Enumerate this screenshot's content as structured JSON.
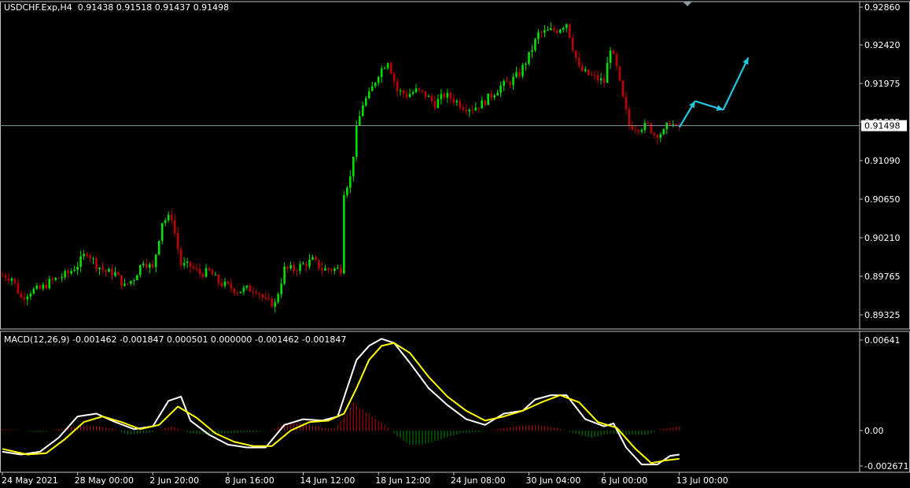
{
  "header": {
    "symbol": "USDCHF.Exp,H4",
    "ohlc": "0.91438 0.91518 0.91437 0.91498"
  },
  "macd_header": {
    "label": "MACD(12,26,9)",
    "values": "-0.001462 -0.001847 0.000501 0.000000 -0.001462 -0.001847"
  },
  "colors": {
    "background": "#000000",
    "bull": "#00e000",
    "bear": "#c00000",
    "macd_line": "#ffffff",
    "signal_line": "#ffff00",
    "hist_up": "#c00000",
    "hist_down": "#008800",
    "arrow": "#22c8e0",
    "current_line": "#8a9aa0"
  },
  "chart_data": [
    {
      "type": "candlestick",
      "title": "USDCHF.Exp,H4",
      "ylim": [
        0.8915,
        0.929
      ],
      "yticks": [
        "0.92860",
        "0.92420",
        "0.91975",
        "0.91535",
        "0.91090",
        "0.90650",
        "0.90210",
        "0.89765",
        "0.89325"
      ],
      "current_price": "0.91498",
      "x_labels": [
        "24 May 2021",
        "28 May 00:00",
        "2 Jun 20:00",
        "8 Jun 16:00",
        "14 Jun 12:00",
        "18 Jun 12:00",
        "24 Jun 08:00",
        "30 Jun 04:00",
        "6 Jul 00:00",
        "13 Jul 00:00"
      ],
      "x_label_bars": [
        0,
        24,
        48,
        72,
        96,
        120,
        144,
        168,
        192,
        216
      ],
      "price_path": [
        [
          0,
          0.8978
        ],
        [
          3,
          0.8975
        ],
        [
          6,
          0.8952
        ],
        [
          9,
          0.896
        ],
        [
          12,
          0.8962
        ],
        [
          15,
          0.897
        ],
        [
          18,
          0.8975
        ],
        [
          21,
          0.898
        ],
        [
          24,
          0.899
        ],
        [
          27,
          0.9005
        ],
        [
          30,
          0.899
        ],
        [
          33,
          0.8982
        ],
        [
          36,
          0.898
        ],
        [
          39,
          0.8965
        ],
        [
          42,
          0.8975
        ],
        [
          45,
          0.8995
        ],
        [
          48,
          0.8985
        ],
        [
          51,
          0.904
        ],
        [
          54,
          0.9045
        ],
        [
          57,
          0.899
        ],
        [
          60,
          0.8988
        ],
        [
          63,
          0.898
        ],
        [
          66,
          0.8982
        ],
        [
          69,
          0.897
        ],
        [
          72,
          0.8965
        ],
        [
          75,
          0.896
        ],
        [
          78,
          0.8962
        ],
        [
          81,
          0.8962
        ],
        [
          84,
          0.8948
        ],
        [
          87,
          0.8945
        ],
        [
          90,
          0.8985
        ],
        [
          93,
          0.8985
        ],
        [
          96,
          0.899
        ],
        [
          99,
          0.8995
        ],
        [
          102,
          0.8985
        ],
        [
          105,
          0.8985
        ],
        [
          108,
          0.8985
        ],
        [
          109,
          0.9075
        ],
        [
          111,
          0.909
        ],
        [
          113,
          0.9145
        ],
        [
          115,
          0.9175
        ],
        [
          117,
          0.9185
        ],
        [
          120,
          0.921
        ],
        [
          123,
          0.9225
        ],
        [
          126,
          0.919
        ],
        [
          129,
          0.9185
        ],
        [
          132,
          0.919
        ],
        [
          135,
          0.9185
        ],
        [
          138,
          0.9175
        ],
        [
          141,
          0.9185
        ],
        [
          144,
          0.918
        ],
        [
          147,
          0.9172
        ],
        [
          150,
          0.917
        ],
        [
          153,
          0.9175
        ],
        [
          156,
          0.9185
        ],
        [
          159,
          0.9195
        ],
        [
          162,
          0.92
        ],
        [
          165,
          0.921
        ],
        [
          168,
          0.923
        ],
        [
          171,
          0.9255
        ],
        [
          174,
          0.9258
        ],
        [
          177,
          0.926
        ],
        [
          180,
          0.9268
        ],
        [
          182,
          0.924
        ],
        [
          184,
          0.9215
        ],
        [
          186,
          0.921
        ],
        [
          189,
          0.9205
        ],
        [
          192,
          0.92
        ],
        [
          194,
          0.924
        ],
        [
          196,
          0.9215
        ],
        [
          198,
          0.918
        ],
        [
          200,
          0.915
        ],
        [
          203,
          0.9148
        ],
        [
          206,
          0.915
        ],
        [
          208,
          0.914
        ],
        [
          211,
          0.9142
        ],
        [
          213,
          0.9155
        ],
        [
          215,
          0.9146
        ],
        [
          216,
          0.915
        ]
      ],
      "forecast_arrows": [
        [
          [
            216,
            0.9148
          ],
          [
            221,
            0.9178
          ]
        ],
        [
          [
            221,
            0.9178
          ],
          [
            230,
            0.9168
          ]
        ],
        [
          [
            230,
            0.9168
          ],
          [
            238,
            0.9228
          ]
        ]
      ],
      "current_price_value": 0.91498
    },
    {
      "type": "line",
      "title": "MACD(12,26,9)",
      "ylim": [
        -0.0032,
        0.0068
      ],
      "yticks": [
        "0.00641",
        "0.00",
        "-0.002671"
      ],
      "series": [
        {
          "name": "MACD",
          "points": [
            [
              0,
              -0.0015
            ],
            [
              6,
              -0.0017
            ],
            [
              12,
              -0.0015
            ],
            [
              18,
              -0.0005
            ],
            [
              24,
              0.001
            ],
            [
              30,
              0.0012
            ],
            [
              36,
              0.0006
            ],
            [
              42,
              0.0001
            ],
            [
              48,
              0.0003
            ],
            [
              53,
              0.0021
            ],
            [
              57,
              0.0024
            ],
            [
              60,
              0.0007
            ],
            [
              66,
              -0.0003
            ],
            [
              72,
              -0.001
            ],
            [
              78,
              -0.0012
            ],
            [
              84,
              -0.0012
            ],
            [
              90,
              0.0004
            ],
            [
              96,
              0.0008
            ],
            [
              102,
              0.0007
            ],
            [
              107,
              0.001
            ],
            [
              110,
              0.003
            ],
            [
              113,
              0.005
            ],
            [
              117,
              0.006
            ],
            [
              121,
              0.0065
            ],
            [
              125,
              0.0062
            ],
            [
              130,
              0.0048
            ],
            [
              136,
              0.003
            ],
            [
              142,
              0.0018
            ],
            [
              148,
              0.0008
            ],
            [
              154,
              0.0004
            ],
            [
              160,
              0.0012
            ],
            [
              166,
              0.0014
            ],
            [
              170,
              0.0022
            ],
            [
              175,
              0.0025
            ],
            [
              180,
              0.0025
            ],
            [
              186,
              0.0008
            ],
            [
              192,
              0.0003
            ],
            [
              195,
              0.0005
            ],
            [
              199,
              -0.0012
            ],
            [
              204,
              -0.0024
            ],
            [
              209,
              -0.0024
            ],
            [
              213,
              -0.0018
            ],
            [
              216,
              -0.0017
            ]
          ]
        },
        {
          "name": "Signal",
          "points": [
            [
              0,
              -0.0013
            ],
            [
              8,
              -0.0017
            ],
            [
              14,
              -0.0016
            ],
            [
              20,
              -0.0006
            ],
            [
              26,
              0.0006
            ],
            [
              32,
              0.001
            ],
            [
              38,
              0.0006
            ],
            [
              44,
              0.0001
            ],
            [
              50,
              0.0004
            ],
            [
              56,
              0.0017
            ],
            [
              62,
              0.0009
            ],
            [
              68,
              -0.0002
            ],
            [
              74,
              -0.0008
            ],
            [
              80,
              -0.0011
            ],
            [
              86,
              -0.0011
            ],
            [
              92,
              0.0
            ],
            [
              98,
              0.0006
            ],
            [
              104,
              0.0007
            ],
            [
              109,
              0.0012
            ],
            [
              113,
              0.003
            ],
            [
              117,
              0.005
            ],
            [
              121,
              0.006
            ],
            [
              125,
              0.0062
            ],
            [
              130,
              0.0055
            ],
            [
              136,
              0.0038
            ],
            [
              142,
              0.0024
            ],
            [
              148,
              0.0014
            ],
            [
              154,
              0.0007
            ],
            [
              160,
              0.001
            ],
            [
              166,
              0.0014
            ],
            [
              172,
              0.002
            ],
            [
              178,
              0.0025
            ],
            [
              184,
              0.002
            ],
            [
              190,
              0.0006
            ],
            [
              196,
              0.0002
            ],
            [
              202,
              -0.0013
            ],
            [
              207,
              -0.0023
            ],
            [
              212,
              -0.0021
            ],
            [
              216,
              -0.002
            ]
          ]
        }
      ],
      "histogram": [
        [
          0,
          0.0001
        ],
        [
          12,
          -0.0001
        ],
        [
          18,
          0.0001
        ],
        [
          24,
          0.0003
        ],
        [
          30,
          0.0003
        ],
        [
          36,
          0.0001
        ],
        [
          40,
          -0.0003
        ],
        [
          48,
          -0.0001
        ],
        [
          54,
          0.0003
        ],
        [
          60,
          -0.0002
        ],
        [
          66,
          -0.0003
        ],
        [
          72,
          -0.0002
        ],
        [
          80,
          -0.0001
        ],
        [
          86,
          0.0
        ],
        [
          90,
          0.0005
        ],
        [
          96,
          0.0005
        ],
        [
          102,
          0.0002
        ],
        [
          106,
          0.0001
        ],
        [
          110,
          0.0012
        ],
        [
          112,
          0.002
        ],
        [
          114,
          0.0016
        ],
        [
          118,
          0.001
        ],
        [
          122,
          0.0004
        ],
        [
          126,
          -0.0004
        ],
        [
          130,
          -0.001
        ],
        [
          134,
          -0.001
        ],
        [
          140,
          -0.0006
        ],
        [
          146,
          -0.0002
        ],
        [
          152,
          -0.0001
        ],
        [
          158,
          0.0001
        ],
        [
          164,
          0.0003
        ],
        [
          170,
          0.0004
        ],
        [
          176,
          0.0002
        ],
        [
          180,
          0.0
        ],
        [
          184,
          -0.0003
        ],
        [
          188,
          -0.0005
        ],
        [
          194,
          -0.0002
        ],
        [
          200,
          -0.0003
        ],
        [
          206,
          -0.0003
        ],
        [
          210,
          0.0001
        ],
        [
          213,
          0.0002
        ],
        [
          216,
          0.0003
        ]
      ]
    }
  ]
}
